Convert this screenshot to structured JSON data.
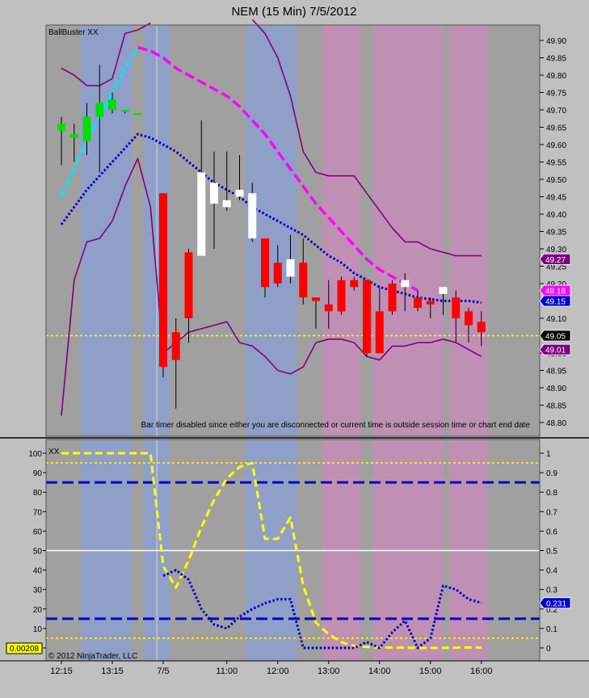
{
  "title": "NEM (15 Min)  7/5/2012",
  "chart_data": [
    {
      "type": "candlestick",
      "indicator_label": "BallBuster XX",
      "notice": "Bar timer disabled since either you are disconnected or current time is outside session time or chart end date",
      "y_ticks": [
        "49.90",
        "49.85",
        "49.80",
        "49.75",
        "49.70",
        "49.65",
        "49.60",
        "49.55",
        "49.50",
        "49.45",
        "49.40",
        "49.35",
        "49.30",
        "49.25",
        "49.20",
        "49.15",
        "49.10",
        "49.05",
        "49.00",
        "48.95",
        "48.90",
        "48.85",
        "48.80"
      ],
      "ylim": [
        48.77,
        49.94
      ],
      "price_markers": [
        {
          "value": 49.27,
          "label": "49.27",
          "color": "#800080"
        },
        {
          "value": 49.18,
          "label": "49.18",
          "color": "#ff00ff"
        },
        {
          "value": 49.15,
          "label": "49.15",
          "color": "#0000cc"
        },
        {
          "value": 49.05,
          "label": "49.05",
          "color": "#000000"
        },
        {
          "value": 49.01,
          "label": "49.01",
          "color": "#800080"
        }
      ],
      "bands": [
        {
          "from": 2,
          "to": 5,
          "color": "#8f9fc8"
        },
        {
          "from": 7,
          "to": 8,
          "color": "#8f9fc8"
        },
        {
          "from": 15,
          "to": 18,
          "color": "#8f9fc8"
        },
        {
          "from": 21,
          "to": 23,
          "color": "#c090b4"
        },
        {
          "from": 25,
          "to": 28,
          "color": "#c090b4"
        },
        {
          "from": 29,
          "to": 29.5,
          "color": "#c090b4"
        },
        {
          "from": 31,
          "to": 33,
          "color": "#c090b4"
        }
      ],
      "candles": [
        {
          "o": 49.64,
          "h": 49.68,
          "l": 49.54,
          "c": 49.66,
          "color": "#00e000"
        },
        {
          "o": 49.62,
          "h": 49.66,
          "l": 49.55,
          "c": 49.63,
          "color": "#00e000"
        },
        {
          "o": 49.61,
          "h": 49.72,
          "l": 49.57,
          "c": 49.68,
          "color": "#00e000"
        },
        {
          "o": 49.68,
          "h": 49.83,
          "l": 49.52,
          "c": 49.72,
          "color": "#00e000"
        },
        {
          "o": 49.7,
          "h": 49.75,
          "l": 49.69,
          "c": 49.73,
          "color": "#00e000"
        },
        {
          "o": 49.7,
          "h": 49.7,
          "l": 49.69,
          "c": 49.7,
          "color": "#00e000"
        },
        {
          "o": 49.69,
          "h": 49.69,
          "l": 49.69,
          "c": 49.69,
          "color": "#00e000"
        },
        null,
        {
          "o": 49.46,
          "h": 49.46,
          "l": 48.93,
          "c": 48.96,
          "color": "#ff0000"
        },
        {
          "o": 49.06,
          "h": 49.1,
          "l": 48.84,
          "c": 48.98,
          "color": "#ff0000"
        },
        {
          "o": 49.29,
          "h": 49.3,
          "l": 49.03,
          "c": 49.1,
          "color": "#ff0000"
        },
        {
          "o": 49.28,
          "h": 49.67,
          "l": 49.28,
          "c": 49.52,
          "color": "#ffffff"
        },
        {
          "o": 49.43,
          "h": 49.58,
          "l": 49.3,
          "c": 49.49,
          "color": "#ffffff"
        },
        {
          "o": 49.42,
          "h": 49.58,
          "l": 49.41,
          "c": 49.44,
          "color": "#ffffff"
        },
        {
          "o": 49.45,
          "h": 49.57,
          "l": 49.44,
          "c": 49.47,
          "color": "#ffffff"
        },
        {
          "o": 49.33,
          "h": 49.49,
          "l": 49.32,
          "c": 49.46,
          "color": "#ffffff"
        },
        {
          "o": 49.33,
          "h": 49.33,
          "l": 49.16,
          "c": 49.19,
          "color": "#ff0000"
        },
        {
          "o": 49.26,
          "h": 49.31,
          "l": 49.19,
          "c": 49.2,
          "color": "#ff0000"
        },
        {
          "o": 49.22,
          "h": 49.34,
          "l": 49.2,
          "c": 49.27,
          "color": "#ffffff"
        },
        {
          "o": 49.26,
          "h": 49.33,
          "l": 49.14,
          "c": 49.16,
          "color": "#ff0000"
        },
        {
          "o": 49.16,
          "h": 49.16,
          "l": 49.07,
          "c": 49.15,
          "color": "#ff0000"
        },
        {
          "o": 49.14,
          "h": 49.21,
          "l": 49.07,
          "c": 49.12,
          "color": "#ff0000"
        },
        {
          "o": 49.21,
          "h": 49.22,
          "l": 49.11,
          "c": 49.12,
          "color": "#ff0000"
        },
        {
          "o": 49.21,
          "h": 49.22,
          "l": 49.18,
          "c": 49.19,
          "color": "#ff0000"
        },
        {
          "o": 49.21,
          "h": 49.21,
          "l": 48.99,
          "c": 49.0,
          "color": "#ff0000"
        },
        {
          "o": 49.12,
          "h": 49.19,
          "l": 49.0,
          "c": 49.0,
          "color": "#ff0000"
        },
        {
          "o": 49.2,
          "h": 49.21,
          "l": 49.11,
          "c": 49.12,
          "color": "#ff0000"
        },
        {
          "o": 49.19,
          "h": 49.23,
          "l": 49.12,
          "c": 49.21,
          "color": "#ffffff"
        },
        {
          "o": 49.16,
          "h": 49.18,
          "l": 49.12,
          "c": 49.13,
          "color": "#ff0000"
        },
        {
          "o": 49.15,
          "h": 49.16,
          "l": 49.1,
          "c": 49.14,
          "color": "#ff0000"
        },
        {
          "o": 49.17,
          "h": 49.19,
          "l": 49.11,
          "c": 49.19,
          "color": "#ffffff"
        },
        {
          "o": 49.16,
          "h": 49.18,
          "l": 49.03,
          "c": 49.1,
          "color": "#ff0000"
        },
        {
          "o": 49.12,
          "h": 49.13,
          "l": 49.03,
          "c": 49.08,
          "color": "#ff0000"
        },
        {
          "o": 49.09,
          "h": 49.12,
          "l": 49.02,
          "c": 49.06,
          "color": "#ff0000"
        }
      ],
      "series": [
        {
          "style": "upper-band",
          "color": "#800080",
          "values": [
            49.82,
            49.8,
            49.77,
            49.77,
            49.79,
            49.92,
            49.93,
            49.95,
            null,
            null,
            null,
            null,
            null,
            null,
            null,
            49.96,
            49.92,
            49.85,
            49.74,
            49.58,
            49.52,
            49.51,
            49.51,
            49.51,
            49.46,
            49.41,
            49.36,
            49.32,
            49.32,
            49.3,
            49.29,
            49.28,
            49.28,
            49.28
          ]
        },
        {
          "style": "magenta-dashed",
          "color": "#ff00ff",
          "values": [
            null,
            null,
            null,
            null,
            null,
            null,
            49.88,
            49.87,
            49.85,
            49.82,
            49.8,
            49.78,
            49.76,
            49.74,
            49.71,
            49.67,
            49.63,
            49.58,
            49.53,
            49.48,
            49.43,
            49.39,
            49.35,
            49.31,
            49.27,
            49.24,
            49.22,
            49.2,
            49.18
          ]
        },
        {
          "style": "cyan-dashed",
          "color": "#00e5ff",
          "values": [
            49.45,
            49.53,
            49.61,
            49.68,
            49.75,
            49.82,
            49.88
          ]
        },
        {
          "style": "blue-dotted",
          "color": "#0000cc",
          "values": [
            49.37,
            49.42,
            49.47,
            49.51,
            49.55,
            49.59,
            49.63,
            49.62,
            49.6,
            49.58,
            49.55,
            49.52,
            49.49,
            49.47,
            49.45,
            49.42,
            49.4,
            49.38,
            49.36,
            49.34,
            49.31,
            49.28,
            49.26,
            49.23,
            49.21,
            49.19,
            49.18,
            49.17,
            49.16,
            49.155,
            49.15,
            49.15,
            49.15,
            49.145
          ]
        },
        {
          "style": "lower-band",
          "color": "#800080",
          "values": [
            48.82,
            49.21,
            49.32,
            49.33,
            49.38,
            49.48,
            49.56,
            49.42,
            49.0,
            49.03,
            49.06,
            49.07,
            49.08,
            49.09,
            49.03,
            49.02,
            48.99,
            48.95,
            48.94,
            48.96,
            49.03,
            49.04,
            49.04,
            49.03,
            48.99,
            48.98,
            49.02,
            49.02,
            49.03,
            49.03,
            49.04,
            49.03,
            49.01,
            48.99
          ]
        }
      ],
      "price_line": {
        "value": 49.05,
        "color": "#ffff00"
      }
    },
    {
      "type": "line",
      "indicator_label": "XX",
      "left_ticks": [
        "100",
        "90",
        "80",
        "70",
        "60",
        "50",
        "40",
        "30",
        "20",
        "10",
        "0"
      ],
      "right_ticks": [
        "1",
        "0.9",
        "0.8",
        "0.7",
        "0.6",
        "0.5",
        "0.4",
        "0.3",
        "0.2",
        "0.1",
        "0"
      ],
      "ylim": [
        -0.05,
        1.02
      ],
      "current_label": "0.231",
      "left_box": "0.00208",
      "hlines": [
        {
          "value": 0.95,
          "color": "#ffff00",
          "style": "dotted"
        },
        {
          "value": 0.85,
          "color": "#0000cc",
          "style": "dashed"
        },
        {
          "value": 0.5,
          "color": "#ffffff",
          "style": "solid"
        },
        {
          "value": 0.15,
          "color": "#0000cc",
          "style": "dashed"
        },
        {
          "value": 0.05,
          "color": "#ffff00",
          "style": "dotted"
        }
      ],
      "series": [
        {
          "style": "yellow-dashed",
          "color": "#ffff00",
          "values": [
            1,
            1,
            1,
            1,
            1,
            1,
            1,
            1,
            0.42,
            0.31,
            0.45,
            0.62,
            0.76,
            0.87,
            0.93,
            0.95,
            0.56,
            0.56,
            0.67,
            0.32,
            0.13,
            0.07,
            0.03,
            0.01,
            0.005,
            0.002,
            0.002,
            0.002,
            0.0,
            0.0,
            0.0,
            0.002,
            0.002,
            0.002
          ]
        },
        {
          "style": "blue-dotted",
          "color": "#0000cc",
          "values": [
            null,
            null,
            null,
            null,
            null,
            null,
            null,
            null,
            0.37,
            0.4,
            0.35,
            0.2,
            0.12,
            0.1,
            0.16,
            0.2,
            0.23,
            0.25,
            0.25,
            0.0,
            0.0,
            0.0,
            0.0,
            0.0,
            0.03,
            0.0,
            0.08,
            0.14,
            0.0,
            0.05,
            0.32,
            0.3,
            0.25,
            0.231
          ]
        }
      ]
    }
  ],
  "x_labels": [
    {
      "label": "12:15",
      "index": 0
    },
    {
      "label": "13:15",
      "index": 4
    },
    {
      "label": "7/5",
      "index": 8
    },
    {
      "label": "11:00",
      "index": 13
    },
    {
      "label": "12:00",
      "index": 17
    },
    {
      "label": "13:00",
      "index": 21
    },
    {
      "label": "14:00",
      "index": 25
    },
    {
      "label": "15:00",
      "index": 29
    },
    {
      "label": "16:00",
      "index": 33
    }
  ],
  "copyright": "© 2012 NinjaTrader, LLC"
}
